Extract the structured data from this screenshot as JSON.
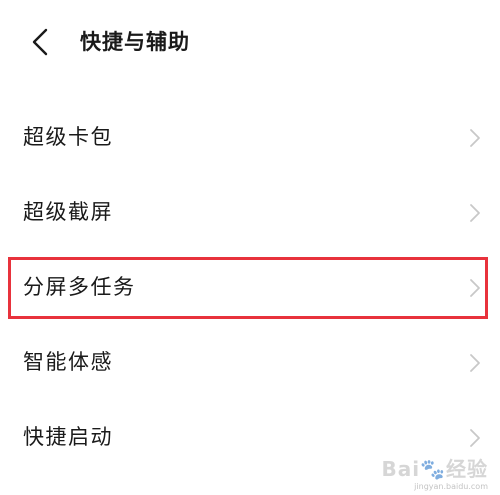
{
  "header": {
    "back_icon": "chevron-left-icon",
    "title": "快捷与辅助"
  },
  "menu": {
    "items": [
      {
        "label": "超级卡包",
        "icon": "chevron-right-icon"
      },
      {
        "label": "超级截屏",
        "icon": "chevron-right-icon"
      },
      {
        "label": "分屏多任务",
        "icon": "chevron-right-icon",
        "highlighted": true
      },
      {
        "label": "智能体感",
        "icon": "chevron-right-icon"
      },
      {
        "label": "快捷启动",
        "icon": "chevron-right-icon"
      }
    ]
  },
  "watermark": {
    "text": "Bai🐾经验",
    "sub": "jingyan.baidu.com"
  },
  "colors": {
    "highlight": "#e8323c",
    "text": "#1a1a1a",
    "chevron": "#c8c8c8",
    "background": "#ffffff"
  }
}
